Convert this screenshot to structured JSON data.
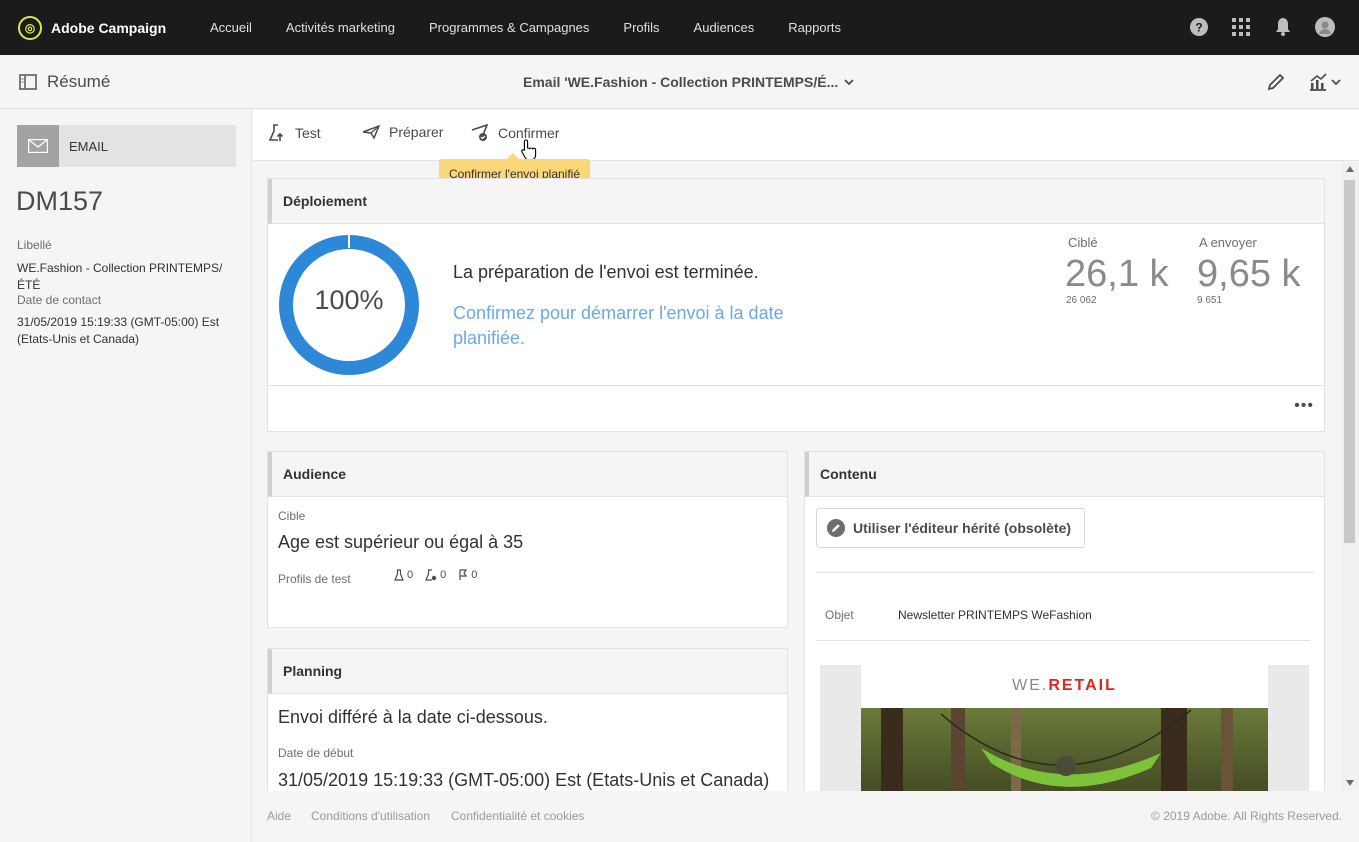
{
  "app": {
    "name": "Adobe Campaign"
  },
  "nav": {
    "items": [
      "Accueil",
      "Activités marketing",
      "Programmes & Campagnes",
      "Profils",
      "Audiences",
      "Rapports"
    ],
    "right_icons": [
      "help-icon",
      "apps-grid-icon",
      "bell-icon",
      "user-avatar-icon"
    ]
  },
  "subbar": {
    "summary_label": "Résumé",
    "doc_title": "Email 'WE.Fashion - Collection PRINTEMPS/É..."
  },
  "sidebar": {
    "type_label": "EMAIL",
    "code": "DM157",
    "libelle_label": "Libellé",
    "libelle_value": "WE.Fashion - Collection PRINTEMPS/ÉTÉ",
    "contact_label": "Date de contact",
    "contact_value": "31/05/2019 15:19:33 (GMT-05:00) Est (Etats-Unis et Canada)"
  },
  "toolbar": {
    "test_label": "Test",
    "prepare_label": "Préparer",
    "confirm_label": "Confirmer",
    "tooltip": "Confirmer l'envoi planifié"
  },
  "deployment": {
    "title": "Déploiement",
    "progress_text": "100%",
    "progress_fraction": 1.0,
    "message": "La préparation de l'envoi est terminée.",
    "link": "Confirmez pour démarrer l'envoi à la date planifiée.",
    "targeted_label": "Ciblé",
    "targeted_big": "26,1 k",
    "targeted_small": "26 062",
    "tosend_label": "A envoyer",
    "tosend_big": "9,65 k",
    "tosend_small": "9 651",
    "more": "•••"
  },
  "audience": {
    "title": "Audience",
    "target_label": "Cible",
    "target_value": "Age est supérieur ou égal à 35",
    "test_profiles_label": "Profils de test",
    "counts": [
      "0",
      "0",
      "0"
    ]
  },
  "planning": {
    "title": "Planning",
    "mode": "Envoi différé à la date ci-dessous.",
    "start_label": "Date de début",
    "start_value": "31/05/2019 15:19:33 (GMT-05:00) Est (Etats-Unis et Canada)"
  },
  "content": {
    "title": "Contenu",
    "editor_button": "Utiliser l'éditeur hérité (obsolète)",
    "subject_label": "Objet",
    "subject_value": "Newsletter PRINTEMPS WeFashion",
    "preview_brand_prefix": "WE.",
    "preview_brand_suffix": "RETAIL"
  },
  "footer": {
    "help": "Aide",
    "terms": "Conditions d'utilisation",
    "privacy": "Confidentialité et cookies",
    "copyright": "© 2019 Adobe. All Rights Reserved."
  },
  "colors": {
    "accent": "#2d89d8",
    "link": "#6aa9e9",
    "tooltip": "#fcd778",
    "brand_red": "#e1251b"
  }
}
